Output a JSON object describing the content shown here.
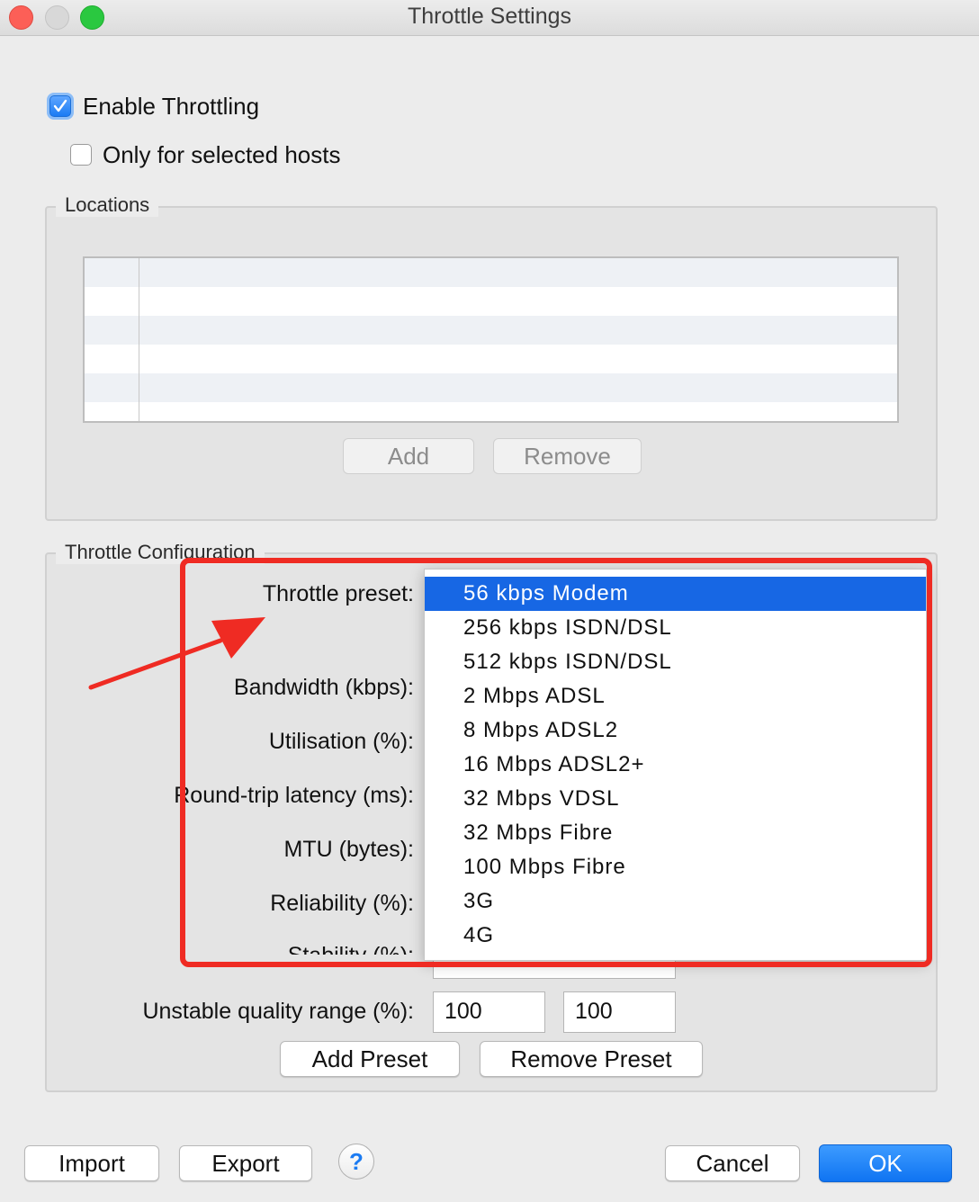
{
  "window": {
    "title": "Throttle Settings"
  },
  "options": {
    "enable_throttling": {
      "label": "Enable Throttling",
      "checked": true
    },
    "only_selected_hosts": {
      "label": "Only for selected hosts",
      "checked": false
    }
  },
  "locations": {
    "title": "Locations",
    "rows": [],
    "add_label": "Add",
    "remove_label": "Remove"
  },
  "config": {
    "title": "Throttle Configuration",
    "preset_label": "Throttle preset:",
    "bandwidth_label": "Bandwidth (kbps):",
    "utilisation_label": "Utilisation (%):",
    "latency_label": "Round-trip latency (ms):",
    "mtu_label": "MTU (bytes):",
    "reliability_label": "Reliability (%):",
    "stability_label": "Stability (%):",
    "unstable_label": "Unstable quality range (%):",
    "unstable_min": "100",
    "unstable_max": "100",
    "add_preset_label": "Add Preset",
    "remove_preset_label": "Remove Preset"
  },
  "preset_dropdown": {
    "selected": "56 kbps Modem",
    "options": [
      "56 kbps Modem",
      "256 kbps ISDN/DSL",
      "512 kbps ISDN/DSL",
      "2 Mbps ADSL",
      "8 Mbps ADSL2",
      "16 Mbps ADSL2+",
      "32 Mbps VDSL",
      "32 Mbps Fibre",
      "100 Mbps Fibre",
      "3G",
      "4G"
    ]
  },
  "footer": {
    "import_label": "Import",
    "export_label": "Export",
    "help_label": "?",
    "cancel_label": "Cancel",
    "ok_label": "OK"
  },
  "colors": {
    "accent": "#1767e4",
    "annotation": "#ef2b23"
  }
}
